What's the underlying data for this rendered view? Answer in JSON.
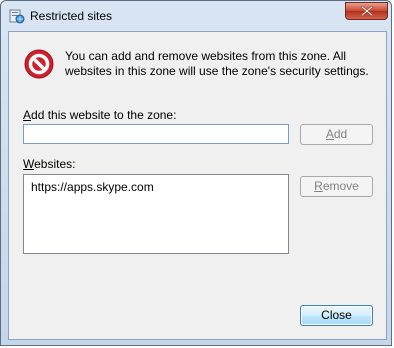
{
  "window": {
    "title": "Restricted sites"
  },
  "info": {
    "text": "You can add and remove websites from this zone. All websites in this zone will use the zone's security settings."
  },
  "add_label": {
    "prefix": "",
    "accel": "A",
    "rest": "dd this website to the zone:"
  },
  "add_input": {
    "value": "",
    "placeholder": ""
  },
  "add_button": {
    "prefix": "",
    "accel": "A",
    "rest": "dd"
  },
  "websites_label": {
    "prefix": "",
    "accel": "W",
    "rest": "ebsites:"
  },
  "websites": [
    "https://apps.skype.com"
  ],
  "remove_button": {
    "prefix": "",
    "accel": "R",
    "rest": "emove"
  },
  "close_button": {
    "label": "Close"
  },
  "colors": {
    "accent": "#3c7fb1",
    "stop": "#d0202e"
  }
}
